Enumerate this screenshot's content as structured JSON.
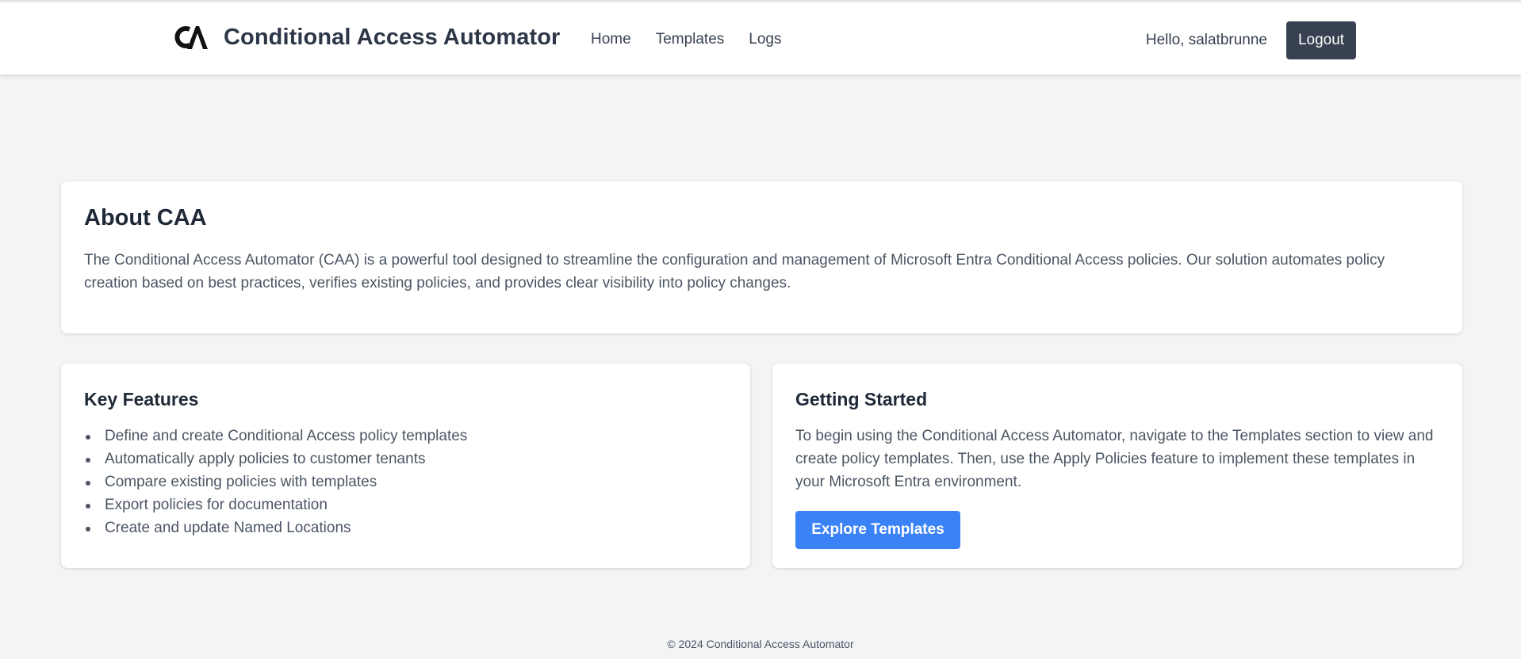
{
  "header": {
    "logo_icon": "caa-logo-icon",
    "app_title": "Conditional Access Automator",
    "nav": [
      {
        "label": "Home"
      },
      {
        "label": "Templates"
      },
      {
        "label": "Logs"
      }
    ],
    "greeting": "Hello, salatbrunne",
    "logout_label": "Logout"
  },
  "about": {
    "title": "About CAA",
    "body": "The Conditional Access Automator (CAA) is a powerful tool designed to streamline the configuration and management of Microsoft Entra Conditional Access policies. Our solution automates policy creation based on best practices, verifies existing policies, and provides clear visibility into policy changes."
  },
  "features": {
    "title": "Key Features",
    "items": [
      "Define and create Conditional Access policy templates",
      "Automatically apply policies to customer tenants",
      "Compare existing policies with templates",
      "Export policies for documentation",
      "Create and update Named Locations"
    ]
  },
  "getting_started": {
    "title": "Getting Started",
    "body": "To begin using the Conditional Access Automator, navigate to the Templates section to view and create policy templates. Then, use the Apply Policies feature to implement these templates in your Microsoft Entra environment.",
    "button_label": "Explore Templates"
  },
  "footer": {
    "copyright": "© 2024 Conditional Access Automator"
  },
  "colors": {
    "page_background": "#f3f4f6",
    "header_background": "#ffffff",
    "logout_button": "#374151",
    "primary_button": "#3b82f6",
    "heading_text": "#1f2937",
    "body_text": "#4b5563"
  }
}
